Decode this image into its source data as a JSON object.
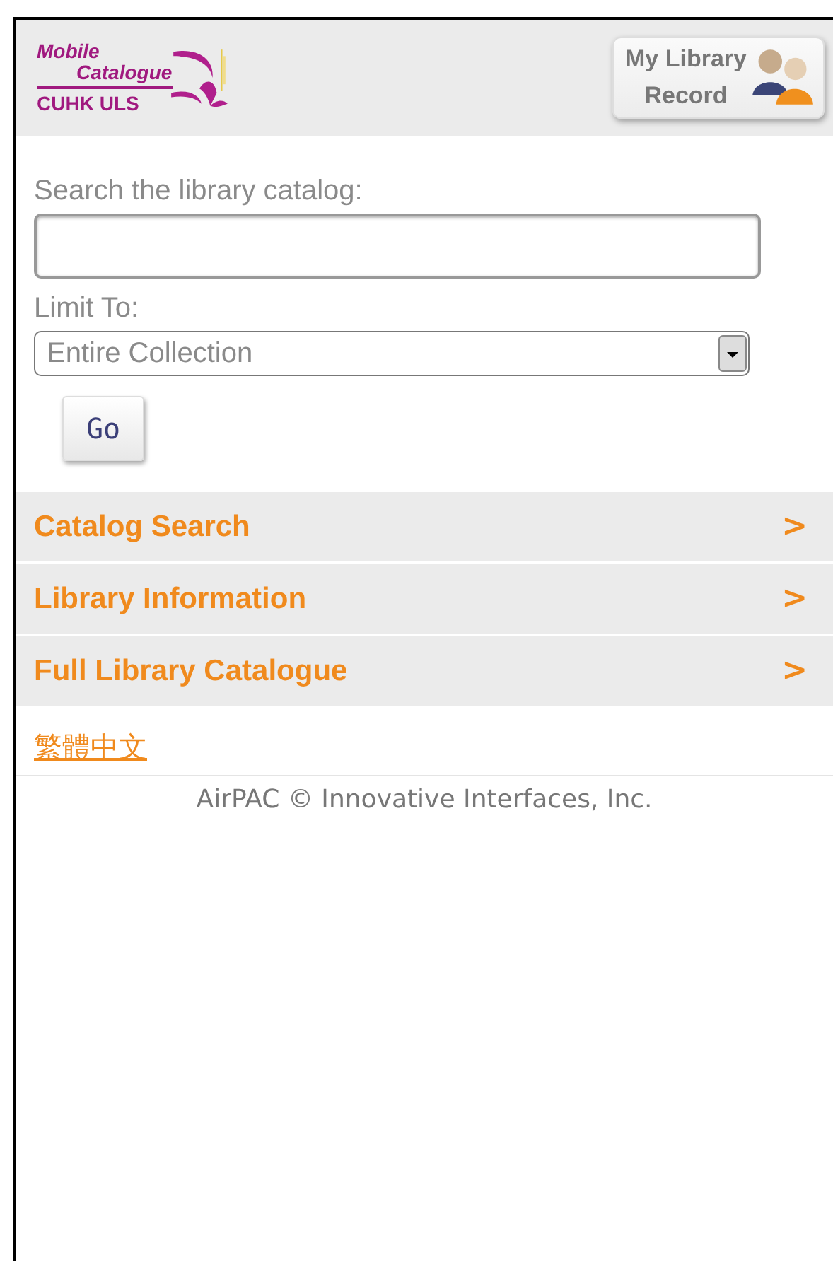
{
  "header": {
    "logo": {
      "title_line1": "Mobile",
      "title_line2": "Catalogue",
      "subtitle": "CUHK ULS"
    },
    "account_button": {
      "line1": "My Library",
      "line2": "Record"
    }
  },
  "search": {
    "label": "Search the library catalog:",
    "limit_label": "Limit To:",
    "limit_value": "Entire Collection",
    "go_button": "Go"
  },
  "menu": [
    {
      "label": "Catalog Search",
      "arrow": ">"
    },
    {
      "label": "Library Information",
      "arrow": ">"
    },
    {
      "label": "Full Library Catalogue",
      "arrow": ">"
    }
  ],
  "language_link": "繁體中文",
  "footer": "AirPAC © Innovative Interfaces, Inc."
}
